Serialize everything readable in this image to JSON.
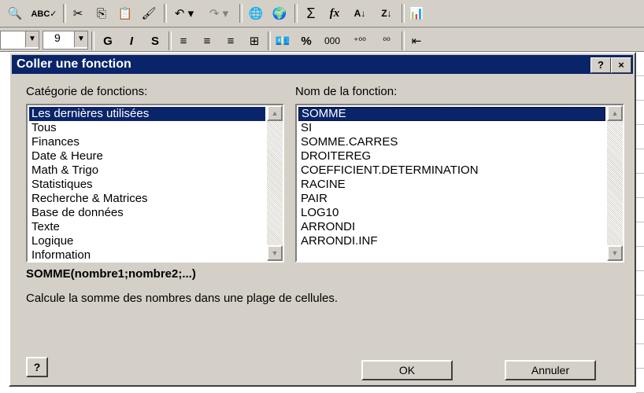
{
  "toolbar1": {
    "items": [
      {
        "name": "print-preview-icon",
        "glyph": "🔍"
      },
      {
        "name": "spelling-icon",
        "glyph": "ABC✓"
      },
      {
        "name": "cut-icon",
        "glyph": "✂"
      },
      {
        "name": "copy-icon",
        "glyph": "⎘"
      },
      {
        "name": "paste-icon",
        "glyph": "📋"
      },
      {
        "name": "format-painter-icon",
        "glyph": "🖌"
      },
      {
        "name": "undo-icon",
        "glyph": "↶ ▾"
      },
      {
        "name": "redo-icon",
        "glyph": "↷ ▾"
      },
      {
        "name": "hyperlink-icon",
        "glyph": "🌐"
      },
      {
        "name": "web-toolbar-icon",
        "glyph": "🌍"
      },
      {
        "name": "autosum-icon",
        "glyph": "Σ"
      },
      {
        "name": "paste-function-icon",
        "glyph": "fx"
      },
      {
        "name": "sort-ascending-icon",
        "glyph": "A↓"
      },
      {
        "name": "sort-descending-icon",
        "glyph": "Z↓"
      },
      {
        "name": "chart-wizard-icon",
        "glyph": "📊"
      }
    ]
  },
  "toolbar2": {
    "font_size": "9",
    "bold": "G",
    "italic": "I",
    "underline": "S",
    "percent": "%",
    "thousands": "000",
    "increase_decimal": "⁺⁰⁰",
    "decrease_decimal": "⁰⁰"
  },
  "dialog": {
    "title": "Coller une fonction",
    "help_button": "?",
    "close_button": "×",
    "category_label": "Catégorie de fonctions:",
    "function_label": "Nom de la fonction:",
    "categories": [
      {
        "label": "Les dernières utilisées",
        "selected": true
      },
      {
        "label": "Tous"
      },
      {
        "label": "Finances"
      },
      {
        "label": "Date & Heure"
      },
      {
        "label": "Math & Trigo"
      },
      {
        "label": "Statistiques"
      },
      {
        "label": "Recherche & Matrices"
      },
      {
        "label": "Base de données"
      },
      {
        "label": "Texte"
      },
      {
        "label": "Logique"
      },
      {
        "label": "Information"
      }
    ],
    "functions": [
      {
        "label": "SOMME",
        "selected": true
      },
      {
        "label": "SI"
      },
      {
        "label": "SOMME.CARRES"
      },
      {
        "label": "DROITEREG"
      },
      {
        "label": "COEFFICIENT.DETERMINATION"
      },
      {
        "label": "RACINE"
      },
      {
        "label": "PAIR"
      },
      {
        "label": "LOG10"
      },
      {
        "label": "ARRONDI"
      },
      {
        "label": "ARRONDI.INF"
      }
    ],
    "syntax": "SOMME(nombre1;nombre2;...)",
    "description": "Calcule la somme des nombres dans une plage de cellules.",
    "ok_label": "OK",
    "cancel_label": "Annuler",
    "office_assistant_icon": "?"
  }
}
